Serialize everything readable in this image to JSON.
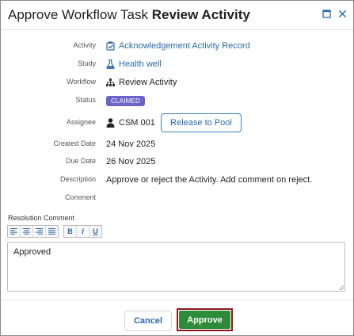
{
  "dialog": {
    "title_prefix": "Approve Workflow Task ",
    "title_task": "Review Activity",
    "window_controls": [
      "maximize-icon",
      "close-icon"
    ]
  },
  "fields": {
    "activity": {
      "label": "Activity",
      "value": "Acknowledgement Activity Record",
      "icon": "checklist-icon"
    },
    "study": {
      "label": "Study",
      "value": "Health well",
      "icon": "flask-icon"
    },
    "workflow": {
      "label": "Workflow",
      "value": "Review Activity",
      "icon": "hierarchy-icon"
    },
    "status": {
      "label": "Status",
      "value": "CLAIMED"
    },
    "assignee": {
      "label": "Assignee",
      "value": "CSM 001",
      "icon": "user-icon"
    },
    "created_date": {
      "label": "Created Date",
      "value": "24 Nov 2025"
    },
    "due_date": {
      "label": "Due Date",
      "value": "26 Nov 2025"
    },
    "description": {
      "label": "Description",
      "value": "Approve or reject the Activity. Add comment on reject."
    },
    "comment": {
      "label": "Comment",
      "value": ""
    }
  },
  "release_button": "Release to Pool",
  "resolution": {
    "label": "Resolution Comment",
    "toolbar": {
      "align_left": "≡",
      "align_center": "≡",
      "align_right": "≡",
      "justify": "≡",
      "bold": "B",
      "italic": "I",
      "underline": "U"
    },
    "value": "Approved"
  },
  "footer": {
    "cancel": "Cancel",
    "approve": "Approve"
  },
  "colors": {
    "link": "#2a6aa8",
    "badge": "#6a64c9",
    "approve": "#2e8b3a",
    "approve_focus_border": "#8b1a1a"
  }
}
